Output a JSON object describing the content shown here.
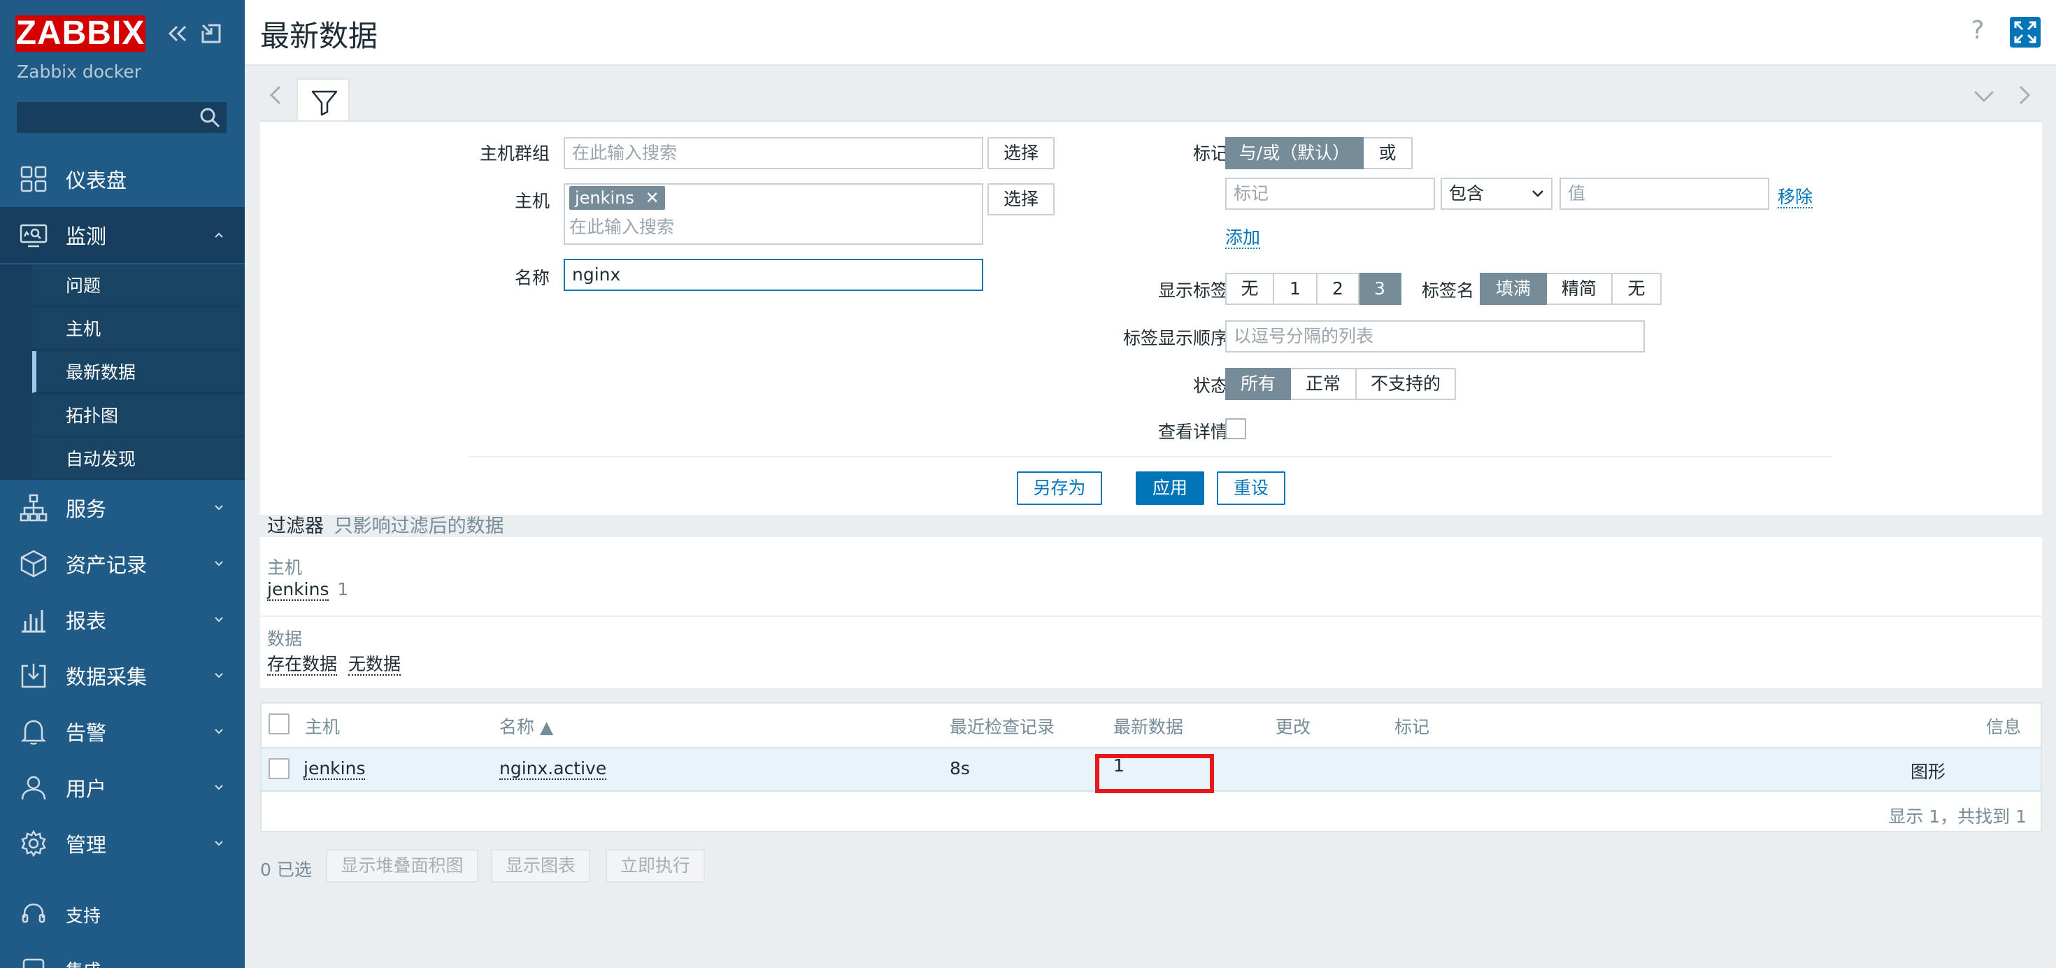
{
  "sidebar": {
    "logo": "ZABBIX",
    "server_name": "Zabbix docker",
    "search_placeholder": "",
    "menu": [
      {
        "label": "仪表盘",
        "icon": "dashboard-icon"
      },
      {
        "label": "监测",
        "icon": "monitoring-icon",
        "expanded": true
      },
      {
        "label": "服务",
        "icon": "services-icon"
      },
      {
        "label": "资产记录",
        "icon": "inventory-icon"
      },
      {
        "label": "报表",
        "icon": "reports-icon"
      },
      {
        "label": "数据采集",
        "icon": "data-collection-icon"
      },
      {
        "label": "告警",
        "icon": "alerts-icon"
      },
      {
        "label": "用户",
        "icon": "users-icon"
      },
      {
        "label": "管理",
        "icon": "administration-icon"
      },
      {
        "label": "支持",
        "icon": "support-icon"
      },
      {
        "label": "集成",
        "icon": "integrations-icon"
      }
    ],
    "submenu": [
      "问题",
      "主机",
      "最新数据",
      "拓扑图",
      "自动发现"
    ],
    "current_submenu": "最新数据"
  },
  "header": {
    "title": "最新数据",
    "help": "?"
  },
  "filter": {
    "host_groups_label": "主机群组",
    "host_groups_placeholder": "在此输入搜索",
    "select_label": "选择",
    "hosts_label": "主机",
    "host_chip": "jenkins",
    "hosts_placeholder": "在此输入搜索",
    "name_label": "名称",
    "name_value": "nginx",
    "tags_label": "标记",
    "tags_logic": [
      "与/或（默认）",
      "或"
    ],
    "tag_placeholder": "标记",
    "tag_operator": "包含",
    "value_placeholder": "值",
    "remove_label": "移除",
    "add_label": "添加",
    "show_tags_label": "显示标签",
    "show_tags_options": [
      "无",
      "1",
      "2",
      "3"
    ],
    "tag_name_label": "标签名",
    "tag_name_options": [
      "填满",
      "精简",
      "无"
    ],
    "tag_order_label": "标签显示顺序",
    "tag_order_placeholder": "以逗号分隔的列表",
    "state_label": "状态",
    "state_options": [
      "所有",
      "正常",
      "不支持的"
    ],
    "details_label": "查看详情",
    "save_as": "另存为",
    "apply": "应用",
    "reset": "重设"
  },
  "subfilter": {
    "title": "过滤器",
    "hint": "只影响过滤后的数据",
    "hosts_label": "主机",
    "host_item": "jenkins",
    "host_count": "1",
    "data_label": "数据",
    "data_with": "存在数据",
    "data_without": "无数据"
  },
  "table": {
    "columns": [
      "主机",
      "名称 ▲",
      "最近检查记录",
      "最新数据",
      "更改",
      "标记",
      "信息"
    ],
    "rows": [
      {
        "host": "jenkins",
        "name": "nginx.active",
        "last_check": "8s",
        "last_value": "1",
        "change": "",
        "tags": "",
        "info": "图形"
      }
    ],
    "footer": "显示 1，共找到 1"
  },
  "bottom": {
    "selected": "0 已选",
    "buttons": [
      "显示堆叠面积图",
      "显示图表",
      "立即执行"
    ]
  },
  "colors": {
    "sidebar": "#1f5b86",
    "accent": "#0275b8",
    "highlight": "#e8161e",
    "logo": "#d40000"
  }
}
